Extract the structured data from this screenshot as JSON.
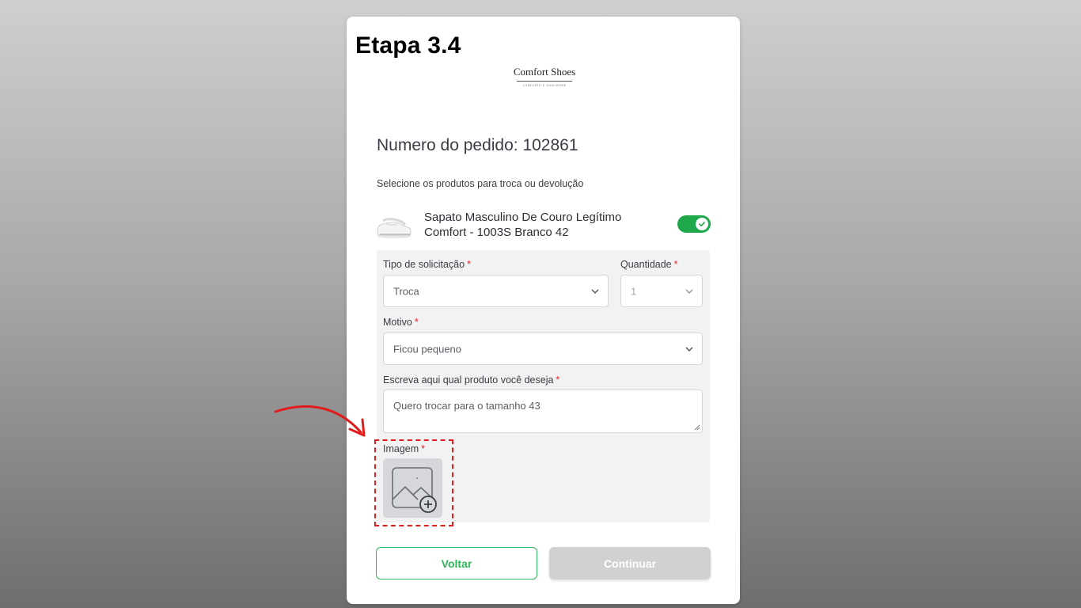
{
  "step": {
    "title": "Etapa 3.4"
  },
  "logo": {
    "name": "Comfort Shoes",
    "tagline": "CONFORTO E QUALIDADE"
  },
  "order": {
    "title": "Numero do pedido: 102861"
  },
  "instructions": "Selecione os produtos para troca ou devolução",
  "product": {
    "name": "Sapato Masculino De Couro Legítimo Comfort - 1003S Branco 42",
    "selected": true
  },
  "form": {
    "request_type": {
      "label": "Tipo de solicitação",
      "value": "Troca"
    },
    "quantity": {
      "label": "Quantidade",
      "value": "1"
    },
    "reason": {
      "label": "Motivo",
      "value": "Ficou pequeno"
    },
    "desired_product": {
      "label": "Escreva aqui qual produto você deseja",
      "value": "Quero trocar para o tamanho 43"
    },
    "image": {
      "label": "Imagem"
    },
    "required_mark": "*"
  },
  "buttons": {
    "back": "Voltar",
    "continue": "Continuar"
  },
  "colors": {
    "accent_green": "#2fb55a",
    "toggle_green": "#1ea84b",
    "required_red": "#e02b2b",
    "highlight_red": "#e01c1c",
    "disabled_button": "#d0d1d3"
  },
  "icons": [
    "shoe-icon",
    "check-icon",
    "chevron-down-icon",
    "image-add-icon",
    "resize-handle-icon",
    "arrow-annotation-icon"
  ]
}
